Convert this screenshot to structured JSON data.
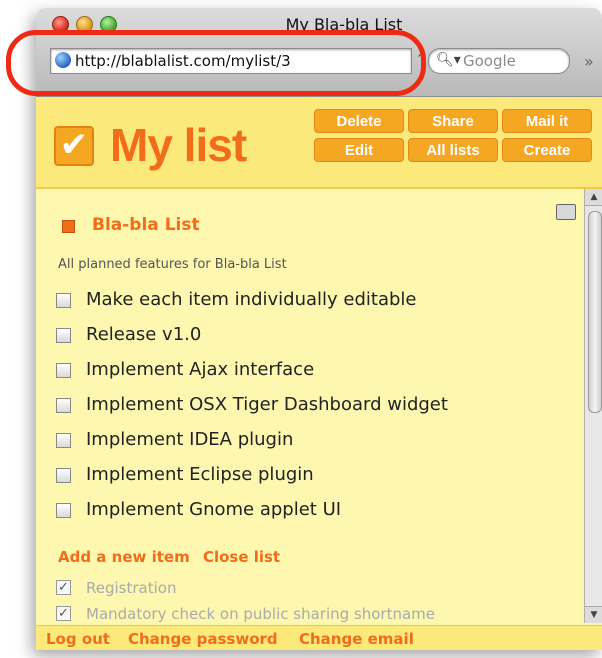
{
  "window": {
    "title": "My Bla-bla List"
  },
  "address_bar": {
    "url": "http://blablalist.com/mylist/3",
    "dropdown_arrow": "⌃"
  },
  "search": {
    "placeholder": "Google"
  },
  "toolbar_overflow": "»",
  "app": {
    "title": "My list",
    "logo_check": "✔",
    "buttons": [
      "Delete",
      "Share",
      "Mail it",
      "Edit",
      "All lists",
      "Create"
    ]
  },
  "list": {
    "name": "Bla-bla List",
    "description": "All planned features for Bla-bla List",
    "items": [
      "Make each item individually editable",
      "Release v1.0",
      "Implement Ajax interface",
      "Implement OSX Tiger Dashboard widget",
      "Implement IDEA plugin",
      "Implement Eclipse plugin",
      "Implement Gnome applet UI"
    ],
    "actions": {
      "add": "Add a new item",
      "close": "Close list"
    },
    "completed": [
      "Registration",
      "Mandatory check on public sharing shortname"
    ],
    "check_glyph": "✓"
  },
  "footer": {
    "logout": "Log out",
    "change_password": "Change password",
    "change_email": "Change email"
  },
  "scroll": {
    "up": "▲",
    "down": "▼"
  },
  "colors": {
    "accent": "#f26d1a",
    "button": "#f5a623",
    "background": "#fdf7b0",
    "annotation": "#ee2a14"
  }
}
